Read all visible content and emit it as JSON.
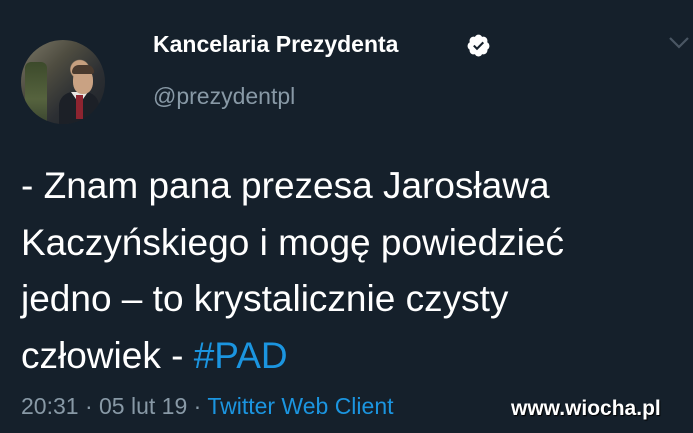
{
  "tweet": {
    "author": {
      "display_name": "Kancelaria Prezydenta",
      "handle": "@prezydentpl",
      "verified": true
    },
    "text_lines": [
      "- Znam pana prezesa Jarosława",
      "Kaczyńskiego i mogę powiedzieć",
      "jedno – to krystalicznie czysty"
    ],
    "text_last_line_prefix": "człowiek - ",
    "hashtag": "#PAD",
    "time": "20:31",
    "separator": "·",
    "date": "05 lut 19",
    "source": "Twitter Web Client"
  },
  "watermark": "www.wiocha.pl",
  "colors": {
    "background": "#15202b",
    "text": "#ffffff",
    "secondary_text": "#8899a6",
    "link": "#1b95e0"
  },
  "icons": {
    "verified": "verified-badge-icon",
    "menu": "chevron-down-icon"
  }
}
